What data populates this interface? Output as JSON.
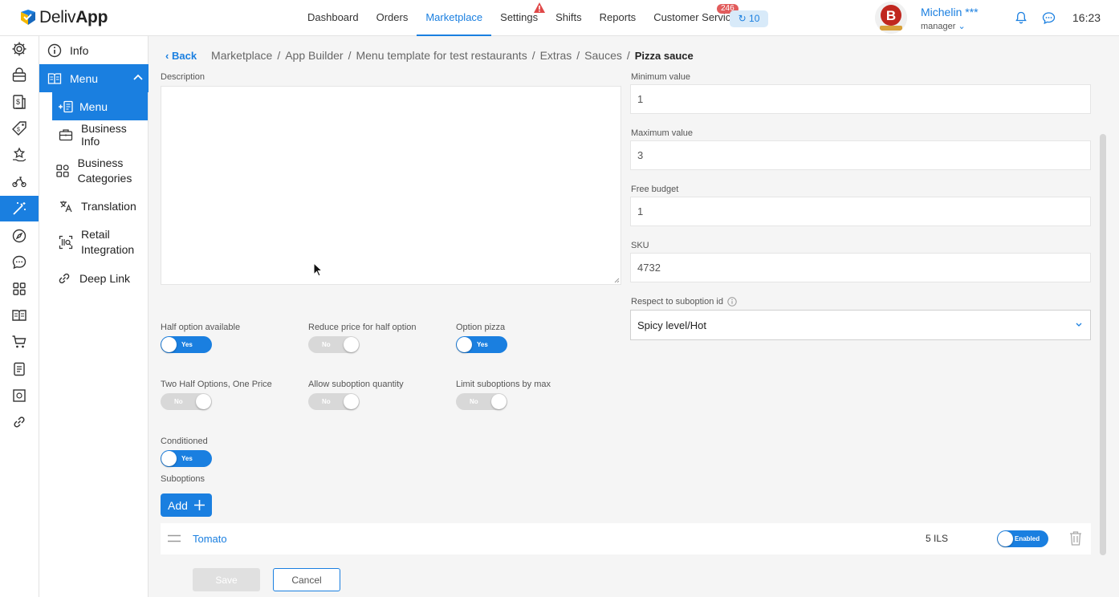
{
  "app": {
    "name_light": "Deliv",
    "name_bold": "App"
  },
  "nav": {
    "items": [
      "Dashboard",
      "Orders",
      "Marketplace",
      "Settings",
      "Shifts",
      "Reports",
      "Customer Service"
    ],
    "active": "Marketplace",
    "cs_badge": "246",
    "redirect_count": "10"
  },
  "user": {
    "name": "Michelin ***",
    "role": "manager",
    "avatar_letter": "B"
  },
  "clock": "16:23",
  "sidebar": {
    "items": [
      {
        "label": "Info"
      },
      {
        "label": "Menu"
      },
      {
        "label": "Menu"
      },
      {
        "label": "Business Info"
      },
      {
        "label": "Business Categories"
      },
      {
        "label": "Translation"
      },
      {
        "label": "Retail Integration"
      },
      {
        "label": "Deep Link"
      }
    ]
  },
  "breadcrumb": {
    "back": "Back",
    "path": [
      "Marketplace",
      "App Builder",
      "Menu template for test restaurants",
      "Extras",
      "Sauces"
    ],
    "current": "Pizza sauce"
  },
  "form": {
    "description_label": "Description",
    "description_value": "",
    "min_label": "Minimum value",
    "min_value": "1",
    "max_label": "Maximum value",
    "max_value": "3",
    "budget_label": "Free budget",
    "budget_value": "1",
    "sku_label": "SKU",
    "sku_value": "4732",
    "respect_label": "Respect to suboption id",
    "respect_value": "Spicy level/Hot",
    "toggles": [
      {
        "label": "Half option available",
        "state": "Yes"
      },
      {
        "label": "Reduce price for half option",
        "state": "No"
      },
      {
        "label": "Option pizza",
        "state": "Yes"
      },
      {
        "label": "Two Half Options, One Price",
        "state": "No"
      },
      {
        "label": "Allow suboption quantity",
        "state": "No"
      },
      {
        "label": "Limit suboptions by max",
        "state": "No"
      },
      {
        "label": "Conditioned",
        "state": "Yes"
      }
    ],
    "suboptions_label": "Suboptions",
    "add_label": "Add",
    "suboptions": [
      {
        "name": "Tomato",
        "price": "5 ILS",
        "status": "Enabled"
      }
    ],
    "save_label": "Save",
    "cancel_label": "Cancel"
  },
  "colors": {
    "accent": "#1a7fe0",
    "badge": "#e25c5c",
    "toggle_off": "#d8d8d8"
  }
}
